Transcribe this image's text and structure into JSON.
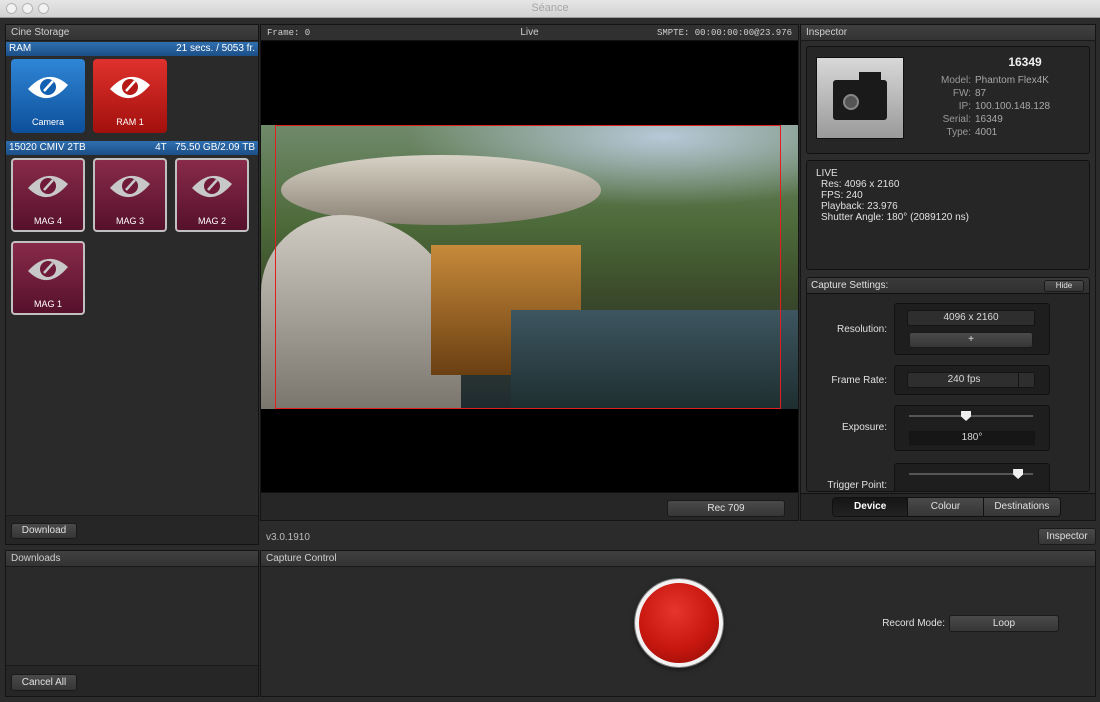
{
  "window": {
    "title": "Séance"
  },
  "cine_storage": {
    "title": "Cine Storage",
    "ram": {
      "label": "RAM",
      "info": "21 secs. / 5053 fr."
    },
    "ram_tiles": [
      {
        "label": "Camera",
        "color": "#1a6bc4"
      },
      {
        "label": "RAM 1",
        "color": "#c9211d"
      }
    ],
    "mag": {
      "label": "15020 CMIV 2TB",
      "type": "4T",
      "info": "75.50 GB/2.09 TB"
    },
    "mag_tiles": [
      {
        "label": "MAG 4"
      },
      {
        "label": "MAG 3"
      },
      {
        "label": "MAG 2"
      },
      {
        "label": "MAG 1"
      }
    ],
    "download_label": "Download"
  },
  "viewer": {
    "frame": "Frame: 0",
    "mode": "Live",
    "smpte": "SMPTE: 00:00:00:00@23.976",
    "lut_label": "Rec 709"
  },
  "version": "v3.0.1910",
  "inspector_toggle_label": "Inspector",
  "inspector": {
    "title": "Inspector",
    "camera_id": "16349",
    "info": [
      {
        "key": "Model:",
        "value": "Phantom Flex4K"
      },
      {
        "key": "FW:",
        "value": "87"
      },
      {
        "key": "IP:",
        "value": "100.100.148.128"
      },
      {
        "key": "Serial:",
        "value": "16349"
      },
      {
        "key": "Type:",
        "value": "4001"
      }
    ],
    "live": {
      "title": "LIVE",
      "lines": [
        "Res: 4096 x 2160",
        "FPS: 240",
        "Playback: 23.976",
        "Shutter Angle: 180° (2089120 ns)"
      ]
    },
    "capture": {
      "title": "Capture Settings:",
      "hide_label": "Hide",
      "resolution_label": "Resolution:",
      "resolution_value": "4096 x 2160",
      "plus_label": "+",
      "framerate_label": "Frame Rate:",
      "framerate_value": "240 fps",
      "exposure_label": "Exposure:",
      "exposure_value": "180°",
      "exposure_level": 0.46,
      "trigger_label": "Trigger Point:",
      "trigger_level": 0.88
    },
    "tabs": [
      "Device",
      "Colour",
      "Destinations"
    ],
    "active_tab": 0
  },
  "downloads": {
    "title": "Downloads",
    "cancel_label": "Cancel All"
  },
  "capture_control": {
    "title": "Capture Control",
    "record_mode_label": "Record Mode:",
    "record_mode_value": "Loop"
  },
  "colors": {
    "record": "#c8170f",
    "accent_blue": "#245c9c",
    "guide": "#e02020"
  }
}
